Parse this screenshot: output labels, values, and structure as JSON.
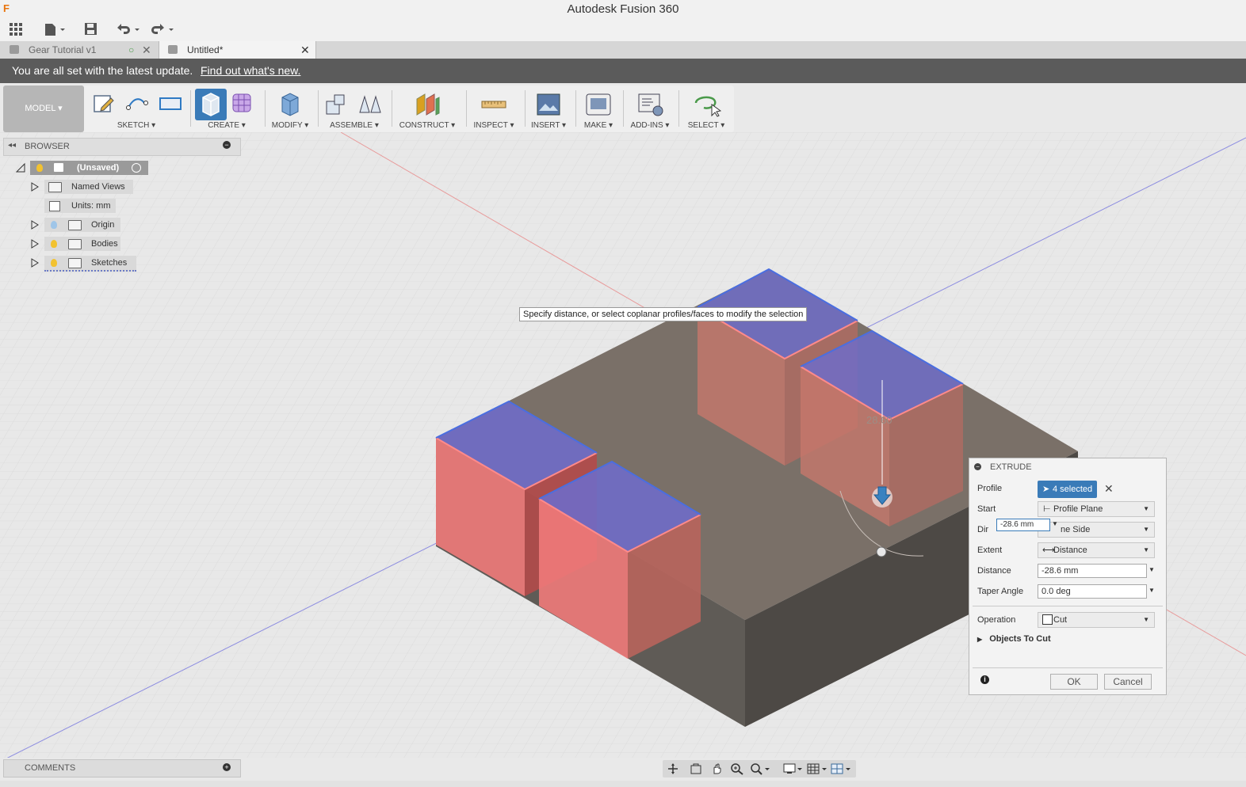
{
  "app": {
    "title": "Autodesk Fusion 360",
    "logo": "F"
  },
  "tabs": [
    {
      "label": "Gear Tutorial v1",
      "active": false
    },
    {
      "label": "Untitled*",
      "active": true
    }
  ],
  "banner": {
    "text": "You are all set with the latest update.",
    "link": "Find out what's new."
  },
  "toolbar": {
    "workspace": "MODEL ▾",
    "groups": [
      {
        "label": "SKETCH ▾"
      },
      {
        "label": "CREATE ▾"
      },
      {
        "label": "MODIFY ▾"
      },
      {
        "label": "ASSEMBLE ▾"
      },
      {
        "label": "CONSTRUCT ▾"
      },
      {
        "label": "INSPECT ▾"
      },
      {
        "label": "INSERT ▾"
      },
      {
        "label": "MAKE ▾"
      },
      {
        "label": "ADD-INS ▾"
      },
      {
        "label": "SELECT ▾"
      }
    ]
  },
  "browser": {
    "title": "BROWSER",
    "root": "(Unsaved)",
    "items": [
      {
        "label": "Named Views"
      },
      {
        "label": "Units: mm"
      },
      {
        "label": "Origin"
      },
      {
        "label": "Bodies"
      },
      {
        "label": "Sketches"
      }
    ]
  },
  "viewport": {
    "tooltip": "Specify distance, or select coplanar profiles/faces to modify the selection",
    "dimension_label": "28.60",
    "inline_input": "-28.6 mm"
  },
  "extrude": {
    "title": "EXTRUDE",
    "profile_label": "Profile",
    "profile_value": "4 selected",
    "start_label": "Start",
    "start_value": "Profile Plane",
    "direction_label": "Dir",
    "direction_value": "ne Side",
    "extent_label": "Extent",
    "extent_value": "Distance",
    "distance_label": "Distance",
    "distance_value": "-28.6 mm",
    "taper_label": "Taper Angle",
    "taper_value": "0.0 deg",
    "operation_label": "Operation",
    "operation_value": "Cut",
    "objects_label": "Objects To Cut",
    "ok": "OK",
    "cancel": "Cancel"
  },
  "comments": {
    "title": "COMMENTS"
  },
  "colors": {
    "accent": "#3a7bb8",
    "banner": "#5b5b5b",
    "cut_face": "#e06868",
    "profile": "#5c5ccc"
  }
}
